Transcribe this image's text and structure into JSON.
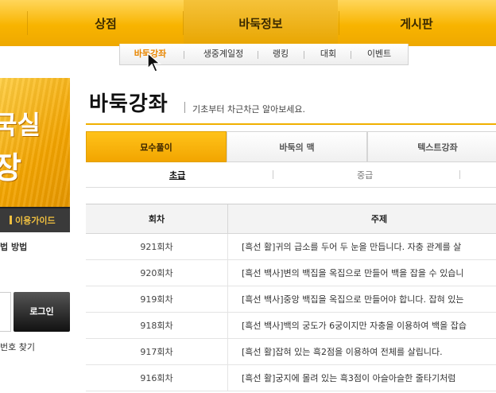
{
  "top_nav": {
    "items": [
      {
        "label": "상점"
      },
      {
        "label": "바둑정보"
      },
      {
        "label": "게시판"
      }
    ]
  },
  "sub_nav": {
    "items": [
      {
        "label": "바둑강좌"
      },
      {
        "label": "생중계일정"
      },
      {
        "label": "랭킹"
      },
      {
        "label": "대회"
      },
      {
        "label": "이벤트"
      }
    ]
  },
  "left_panel": {
    "banner_text_1": "국실",
    "banner_text_2": "장",
    "guide_button": "이용가이드",
    "text_1": "법 방법",
    "login_button": "로그인",
    "text_2": "번호 찾기"
  },
  "page": {
    "title": "바둑강좌",
    "subtitle": "기초부터 차근차근 알아보세요."
  },
  "tabs": [
    {
      "label": "묘수풀이"
    },
    {
      "label": "바둑의 맥"
    },
    {
      "label": "텍스트강좌"
    }
  ],
  "levels": [
    {
      "label": "초급"
    },
    {
      "label": "중급"
    }
  ],
  "table": {
    "headers": {
      "episode": "회차",
      "topic": "주제"
    },
    "rows": [
      {
        "episode": "921회차",
        "topic": "[흑선 활]귀의 급소를 두어 두 눈을 만듭니다. 자충 관계를 살"
      },
      {
        "episode": "920회차",
        "topic": "[흑선 백사]변의 백집을 옥집으로 만들어 백을 잡을 수 있습니"
      },
      {
        "episode": "919회차",
        "topic": "[흑선 백사]중앙 백집을 옥집으로 만들어야 합니다. 잡혀 있는"
      },
      {
        "episode": "918회차",
        "topic": "[흑선 백사]백의 궁도가 6궁이지만 자충을 이용하여 백을 잡습"
      },
      {
        "episode": "917회차",
        "topic": "[흑선 활]잡혀 있는 흑2점을 이용하여 전체를 살립니다."
      },
      {
        "episode": "916회차",
        "topic": "[흑선 활]궁지에 몰려 있는 흑3점이 아슬아슬한 줄타기처럼"
      }
    ]
  }
}
